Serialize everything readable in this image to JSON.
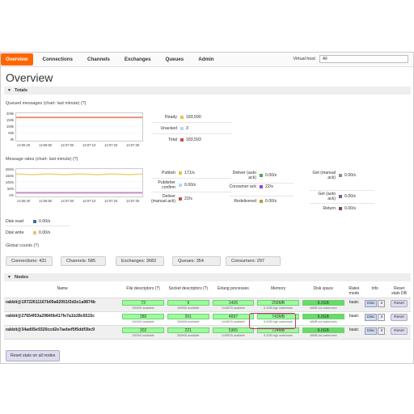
{
  "nav": {
    "tabs": [
      "Overview",
      "Connections",
      "Channels",
      "Exchanges",
      "Queues",
      "Admin"
    ],
    "vhost_label": "Virtual host:",
    "vhost_value": "All"
  },
  "page_title": "Overview",
  "totals": {
    "header": "Totals",
    "queued_title": "Queued messages (chart: last minute) (?)",
    "queued_yticks": [
      "200k",
      "150k",
      "100k",
      "50k",
      "0k"
    ],
    "queued_xticks": [
      "14:06:40",
      "14:06:50",
      "14:07:00",
      "14:07:10",
      "14:07:20",
      "14:07:30"
    ],
    "ready_label": "Ready",
    "ready_value": "183,590",
    "ready_color": "#edc240",
    "unacked_label": "Unacked",
    "unacked_value": "3",
    "unacked_color": "#afd8f8",
    "total_label": "Total",
    "total_value": "183,593",
    "total_color": "#cb4b4b",
    "rates_title": "Message rates (chart: last minute) (?)",
    "rates_yticks": [
      "200/s",
      "150/s",
      "100/s",
      "50/s",
      "0/s"
    ],
    "rates_xticks": [
      "14:06:40",
      "14:06:50",
      "14:07:00",
      "14:07:10",
      "14:07:20",
      "14:07:30"
    ],
    "rates": {
      "publish_label": "Publish",
      "publish_value": "171/s",
      "publish_color": "#edc240",
      "pubconfirm_label": "Publisher confirm",
      "pubconfirm_value": "0.00/s",
      "pubconfirm_color": "#afd8f8",
      "deliver_manual_label": "Deliver (manual ack)",
      "deliver_manual_value": "22/s",
      "deliver_manual_color": "#cb4b4b",
      "deliver_auto_label": "Deliver (auto ack)",
      "deliver_auto_value": "0.00/s",
      "deliver_auto_color": "#4da74d",
      "consumer_ack_label": "Consumer ack",
      "consumer_ack_value": "22/s",
      "consumer_ack_color": "#9440ed",
      "redelivered_label": "Redelivered",
      "redelivered_value": "0.00/s",
      "redelivered_color": "#bd9b33",
      "get_manual_label": "Get (manual ack)",
      "get_manual_value": "0.00/s",
      "get_manual_color": "#8c8c8c",
      "get_auto_label": "Get (auto ack)",
      "get_auto_value": "0.00/s",
      "get_auto_color": "#7d5a9a",
      "return_label": "Return",
      "return_value": "0.00/s",
      "return_color": "#8b3a5a"
    },
    "disk_read_label": "Disk read",
    "disk_read_value": "0.00/s",
    "disk_read_color": "#3d6e9e",
    "disk_write_label": "Disk write",
    "disk_write_value": "0.00/s",
    "disk_write_color": "#d9c873"
  },
  "global_counts": {
    "title": "Global counts (?)",
    "connections": "Connections: 431",
    "channels": "Channels: 585",
    "exchanges": "Exchanges: 3682",
    "queues": "Queues: 354",
    "consumers": "Consumers: 297"
  },
  "nodes": {
    "header": "Nodes",
    "columns": [
      "Name",
      "File descriptors (?)",
      "Socket descriptors (?)",
      "Erlang processes",
      "Memory",
      "Disk space",
      "Rates mode",
      "Info",
      "Reset stats DB"
    ],
    "rows": [
      {
        "name": "rabbit@19722611167b09a62051f2d2e1a9874b",
        "fd": "73",
        "fd_sub": "300000 available",
        "sd": "9",
        "sd_sub": "269908 available",
        "ep": "1426",
        "ep_sub": "1048576 available",
        "mem": "255MB",
        "mem_sub": "6.3GB high watermark",
        "disk": "9.2GB",
        "disk_sub": "48MB low watermark",
        "rates": "basic",
        "disc": "Disc",
        "disc_n": "3",
        "reset": "Reset"
      },
      {
        "name": "rabbit@27654f03a29840b417fe7a1b28c6515c",
        "fd": "280",
        "fd_sub": "300000 available",
        "sd": "201",
        "sd_sub": "269908 available",
        "ep": "4697",
        "ep_sub": "1048576 available",
        "mem": "743MB",
        "mem_sub": "6.3GB high watermark",
        "disk": "9.0GB",
        "disk_sub": "48MB low watermark",
        "rates": "basic",
        "disc": "Disc",
        "disc_n": "3",
        "reset": "Reset"
      },
      {
        "name": "rabbit@34ad05e9320ccd2e7aebef5f5ddf3bc9",
        "fd": "302",
        "fd_sub": "300000 available",
        "sd": "221",
        "sd_sub": "269908 available",
        "ep": "5365",
        "ep_sub": "1048576 available",
        "mem": "724MB",
        "mem_sub": "6.3GB high watermark",
        "disk": "9.0GB",
        "disk_sub": "48MB low watermark",
        "rates": "basic",
        "disc": "Disc",
        "disc_n": "3",
        "reset": "Reset"
      }
    ],
    "reset_all": "Reset stats on all nodes"
  }
}
